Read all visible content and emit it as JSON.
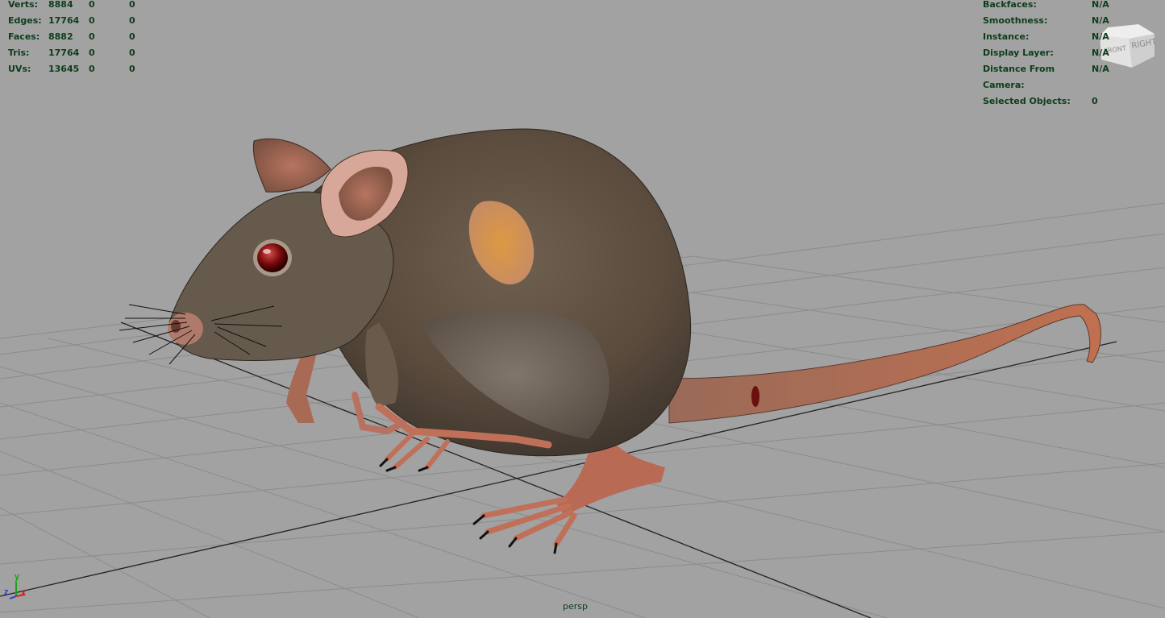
{
  "stats": {
    "left": [
      {
        "label": "Verts:",
        "values": [
          "8884",
          "0",
          "0"
        ]
      },
      {
        "label": "Edges:",
        "values": [
          "17764",
          "0",
          "0"
        ]
      },
      {
        "label": "Faces:",
        "values": [
          "8882",
          "0",
          "0"
        ]
      },
      {
        "label": "Tris:",
        "values": [
          "17764",
          "0",
          "0"
        ]
      },
      {
        "label": "UVs:",
        "values": [
          "13645",
          "0",
          "0"
        ]
      }
    ],
    "right": [
      {
        "label": "Backfaces:",
        "value": "N/A"
      },
      {
        "label": "Smoothness:",
        "value": "N/A"
      },
      {
        "label": "Instance:",
        "value": "N/A"
      },
      {
        "label": "Display Layer:",
        "value": "N/A"
      },
      {
        "label": "Distance From Camera:",
        "value": "N/A"
      },
      {
        "label": "Selected Objects:",
        "value": "0"
      }
    ]
  },
  "viewcube": {
    "front": "FRONT",
    "right": "RIGHT"
  },
  "axis": {
    "x": "x",
    "y": "y",
    "z": "z"
  },
  "camera": "persp",
  "colors": {
    "background": "#a2a2a2",
    "grid": "#8a8a8a",
    "hud_text": "#0c3d1a"
  }
}
